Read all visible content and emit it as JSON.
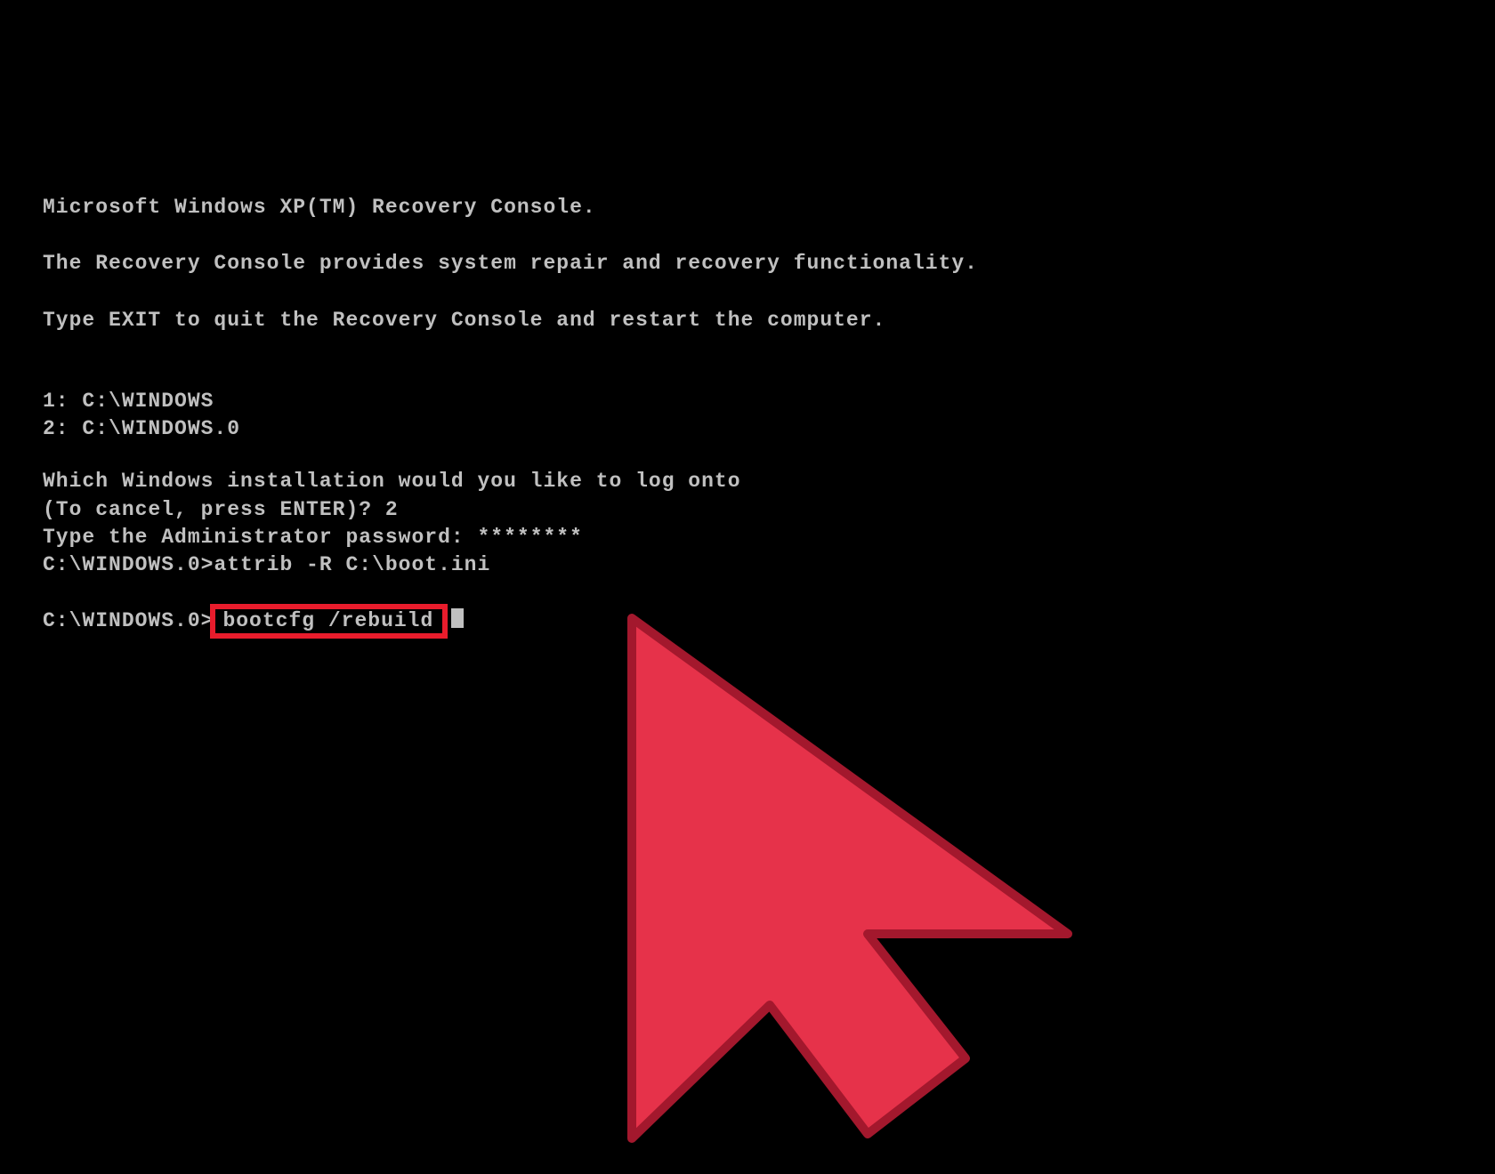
{
  "console": {
    "title": "Microsoft Windows XP(TM) Recovery Console.",
    "description": "The Recovery Console provides system repair and recovery functionality.",
    "exit_instruction": "Type EXIT to quit the Recovery Console and restart the computer.",
    "installations": [
      "1: C:\\WINDOWS",
      "2: C:\\WINDOWS.0"
    ],
    "which_install_prompt": "Which Windows installation would you like to log onto",
    "cancel_prompt": "(To cancel, press ENTER)? ",
    "cancel_answer": "2",
    "password_prompt": "Type the Administrator password: ",
    "password_masked": "********",
    "prev_prompt": "C:\\WINDOWS.0>",
    "prev_command": "attrib -R C:\\boot.ini",
    "curr_prompt": "C:\\WINDOWS.0>",
    "curr_command": "bootcfg /rebuild"
  },
  "annotation": {
    "highlight_color": "#e91c2c",
    "arrow_fill": "#e6324a",
    "arrow_stroke": "#a3182d"
  }
}
